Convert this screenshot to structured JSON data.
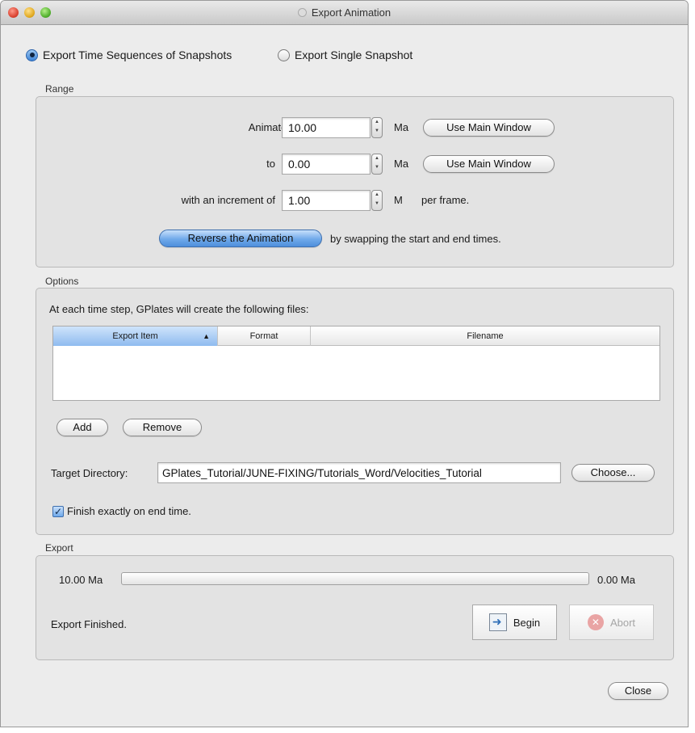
{
  "window": {
    "title": "Export Animation"
  },
  "mode": {
    "sequence_label": "Export Time Sequences of Snapshots",
    "single_label": "Export Single Snapshot",
    "selected": "sequence"
  },
  "range": {
    "group_label": "Range",
    "from_label": "Animate from",
    "from_value": "10.00",
    "from_unit": "Ma",
    "to_label": "to",
    "to_value": "0.00",
    "to_unit": "Ma",
    "increment_label": "with an increment of",
    "increment_value": "1.00",
    "increment_unit": "M",
    "per_frame": "per frame.",
    "use_main_window_label": "Use Main Window",
    "reverse_label": "Reverse the Animation",
    "reverse_hint": "by swapping the start and end times."
  },
  "options": {
    "group_label": "Options",
    "intro": "At each time step, GPlates will create the following files:",
    "columns": [
      "Export Item",
      "Format",
      "Filename"
    ],
    "rows": [],
    "add_label": "Add",
    "remove_label": "Remove",
    "target_label": "Target Directory:",
    "target_value": "GPlates_Tutorial/JUNE-FIXING/Tutorials_Word/Velocities_Tutorial",
    "choose_label": "Choose...",
    "finish_label": "Finish exactly on end time.",
    "finish_checked": true
  },
  "export": {
    "group_label": "Export",
    "start_time": "10.00 Ma",
    "end_time": "0.00 Ma",
    "progress": 0.0,
    "status": "Export Finished.",
    "begin_label": "Begin",
    "abort_label": "Abort"
  },
  "footer": {
    "close_label": "Close"
  },
  "colors": {
    "accent": "#6fa9ea",
    "window_bg": "#ececec",
    "group_bg": "#e3e3e3"
  }
}
